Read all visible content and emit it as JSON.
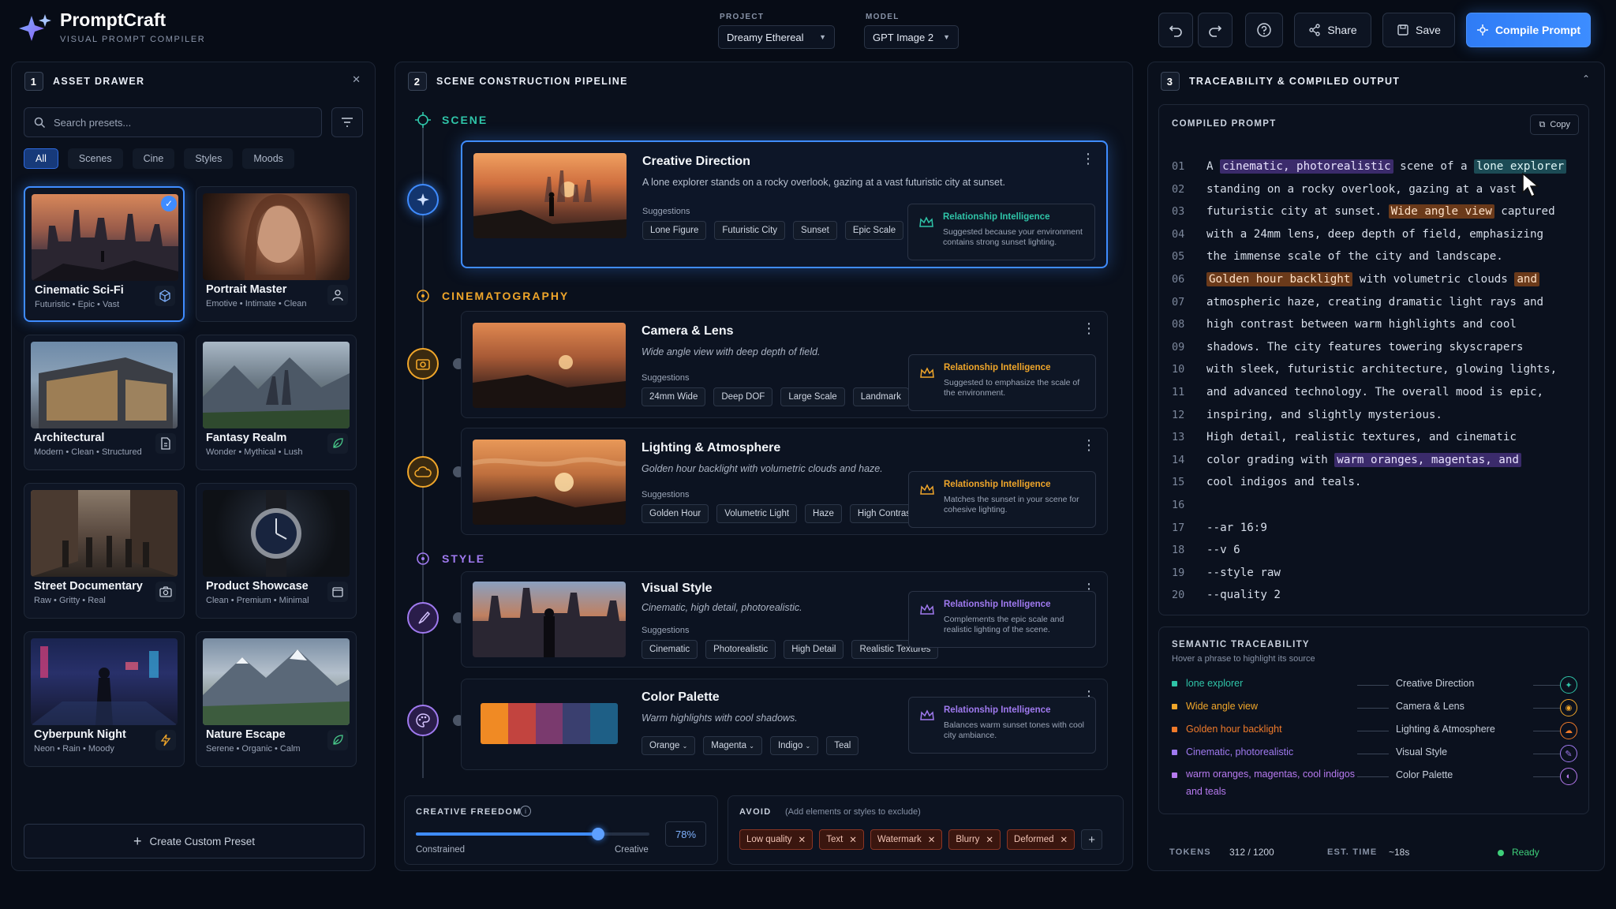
{
  "app": {
    "title": "PromptCraft",
    "subtitle": "VISUAL PROMPT COMPILER"
  },
  "toolbar": {
    "project_label": "PROJECT",
    "project_value": "Dreamy Ethereal",
    "model_label": "MODEL",
    "model_value": "GPT Image 2",
    "share": "Share",
    "save": "Save",
    "compile": "Compile Prompt"
  },
  "drawer": {
    "num": "1",
    "title": "ASSET DRAWER",
    "search_placeholder": "Search presets...",
    "filters": [
      "All",
      "Scenes",
      "Cine",
      "Styles",
      "Moods"
    ],
    "cards": [
      {
        "name": "Cinematic Sci-Fi",
        "tags": "Futuristic • Epic • Vast",
        "icon": "cube-icon"
      },
      {
        "name": "Portrait Master",
        "tags": "Emotive • Intimate • Clean",
        "icon": "user-icon"
      },
      {
        "name": "Architectural",
        "tags": "Modern • Clean • Structured",
        "icon": "document-icon"
      },
      {
        "name": "Fantasy Realm",
        "tags": "Wonder • Mythical • Lush",
        "icon": "leaf-icon"
      },
      {
        "name": "Street Documentary",
        "tags": "Raw • Gritty • Real",
        "icon": "camera-icon"
      },
      {
        "name": "Product Showcase",
        "tags": "Clean • Premium • Minimal",
        "icon": "box-icon"
      },
      {
        "name": "Cyberpunk Night",
        "tags": "Neon • Rain • Moody",
        "icon": "bolt-icon"
      },
      {
        "name": "Nature Escape",
        "tags": "Serene • Organic • Calm",
        "icon": "leaf-icon"
      }
    ],
    "create": "Create Custom Preset"
  },
  "pipeline": {
    "num": "2",
    "title": "SCENE CONSTRUCTION PIPELINE",
    "sections": {
      "scene": "SCENE",
      "cine": "CINEMATOGRAPHY",
      "style": "STYLE"
    },
    "suggestions_label": "Suggestions",
    "ri_title": "Relationship Intelligence",
    "cards": [
      {
        "title": "Creative Direction",
        "desc": "A lone explorer stands on a rocky overlook, gazing at a vast futuristic city at sunset.",
        "tags": [
          "Lone Figure",
          "Futuristic City",
          "Sunset",
          "Epic Scale"
        ],
        "ri": "Suggested because your environment contains strong sunset lighting."
      },
      {
        "title": "Camera & Lens",
        "desc": "Wide angle view with deep depth of field.",
        "tags": [
          "24mm Wide",
          "Deep DOF",
          "Large Scale",
          "Landmark"
        ],
        "ri": "Suggested to emphasize the scale of the environment."
      },
      {
        "title": "Lighting & Atmosphere",
        "desc": "Golden hour backlight with volumetric clouds and haze.",
        "tags": [
          "Golden Hour",
          "Volumetric Light",
          "Haze",
          "High Contrast"
        ],
        "ri": "Matches the sunset in your scene for cohesive lighting."
      },
      {
        "title": "Visual Style",
        "desc": "Cinematic, high detail, photorealistic.",
        "tags": [
          "Cinematic",
          "Photorealistic",
          "High Detail",
          "Realistic Textures"
        ],
        "ri": "Complements the epic scale and realistic lighting of the scene."
      },
      {
        "title": "Color Palette",
        "desc": "Warm highlights with cool shadows.",
        "tags": [
          "Orange",
          "Magenta",
          "Indigo",
          "Teal"
        ],
        "ri": "Balances warm sunset tones with cool city ambiance.",
        "swatches": [
          "#f08a24",
          "#c2443f",
          "#7a3a6e",
          "#3a3f6f",
          "#1e5f86"
        ]
      }
    ],
    "freedom": {
      "label": "CREATIVE FREEDOM",
      "min": "Constrained",
      "max": "Creative",
      "value": "78%",
      "level": 0.78
    },
    "avoid": {
      "label": "AVOID",
      "hint": "(Add elements or styles to exclude)",
      "items": [
        "Low quality",
        "Text",
        "Watermark",
        "Blurry",
        "Deformed"
      ]
    }
  },
  "output": {
    "num": "3",
    "title": "TRACEABILITY & COMPILED OUTPUT",
    "compiled_label": "COMPILED PROMPT",
    "copy": "Copy",
    "lines": [
      {
        "n": "01",
        "segs": [
          [
            "A ",
            ""
          ],
          [
            "cinematic, photorealistic",
            "p"
          ],
          [
            " scene of a ",
            ""
          ],
          [
            "lone explorer",
            "t"
          ]
        ]
      },
      {
        "n": "02",
        "segs": [
          [
            "standing on a rocky overlook, gazing at a vast",
            ""
          ]
        ]
      },
      {
        "n": "03",
        "segs": [
          [
            "futuristic city at sunset. ",
            ""
          ],
          [
            "Wide angle view",
            "o"
          ],
          [
            " captured",
            ""
          ]
        ]
      },
      {
        "n": "04",
        "segs": [
          [
            "with a 24mm lens, deep depth of field, emphasizing",
            ""
          ]
        ]
      },
      {
        "n": "05",
        "segs": [
          [
            "the immense scale of the city and landscape.",
            ""
          ]
        ]
      },
      {
        "n": "06",
        "segs": [
          [
            "Golden hour backlight",
            "o"
          ],
          [
            " with volumetric clouds ",
            ""
          ],
          [
            "and",
            "o"
          ]
        ]
      },
      {
        "n": "07",
        "segs": [
          [
            "atmospheric haze, creating dramatic light rays and",
            ""
          ]
        ]
      },
      {
        "n": "08",
        "segs": [
          [
            "high contrast between warm highlights and cool",
            ""
          ]
        ]
      },
      {
        "n": "09",
        "segs": [
          [
            "shadows. The city features towering skyscrapers",
            ""
          ]
        ]
      },
      {
        "n": "10",
        "segs": [
          [
            "with sleek, futuristic architecture, glowing lights,",
            ""
          ]
        ]
      },
      {
        "n": "11",
        "segs": [
          [
            "and advanced technology. The overall mood is epic,",
            ""
          ]
        ]
      },
      {
        "n": "12",
        "segs": [
          [
            "inspiring, and slightly mysterious.",
            ""
          ]
        ]
      },
      {
        "n": "13",
        "segs": [
          [
            "High detail, realistic textures, and cinematic",
            ""
          ]
        ]
      },
      {
        "n": "14",
        "segs": [
          [
            "color grading with ",
            ""
          ],
          [
            "warm oranges, magentas, and",
            "p"
          ]
        ]
      },
      {
        "n": "15",
        "segs": [
          [
            "cool indigos and teals.",
            ""
          ]
        ]
      },
      {
        "n": "16",
        "segs": [
          [
            "",
            ""
          ]
        ]
      },
      {
        "n": "17",
        "segs": [
          [
            "--ar 16:9",
            ""
          ]
        ]
      },
      {
        "n": "18",
        "segs": [
          [
            "--v 6",
            ""
          ]
        ]
      },
      {
        "n": "19",
        "segs": [
          [
            "--style raw",
            ""
          ]
        ]
      },
      {
        "n": "20",
        "segs": [
          [
            "--quality 2",
            ""
          ]
        ]
      }
    ],
    "trace_title": "SEMANTIC TRACEABILITY",
    "trace_hint": "Hover a phrase to highlight its source",
    "trace": [
      {
        "src": "lone explorer",
        "dst": "Creative Direction",
        "color": "#2fc4a8"
      },
      {
        "src": "Wide angle view",
        "dst": "Camera & Lens",
        "color": "#f0a62a"
      },
      {
        "src": "Golden hour backlight",
        "dst": "Lighting & Atmosphere",
        "color": "#f07a2a"
      },
      {
        "src": "Cinematic, photorealistic",
        "dst": "Visual Style",
        "color": "#a07af0"
      },
      {
        "src": "warm oranges, magentas, cool indigos and teals",
        "dst": "Color Palette",
        "color": "#b77af0"
      }
    ],
    "tokens_label": "TOKENS",
    "tokens": "312 / 1200",
    "time_label": "EST. TIME",
    "time": "~18s",
    "status": "Ready"
  }
}
